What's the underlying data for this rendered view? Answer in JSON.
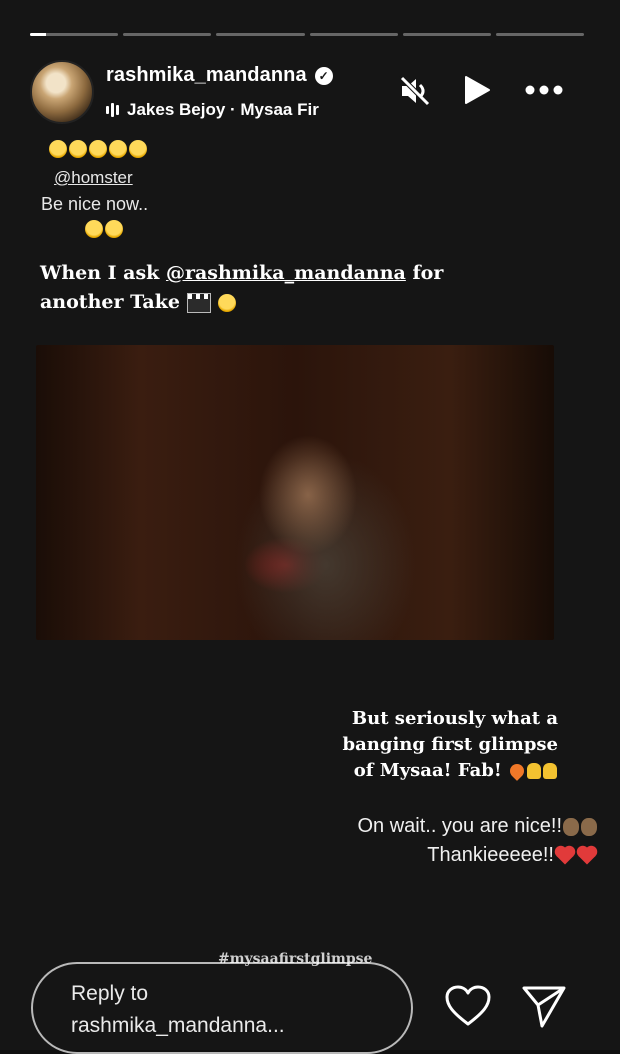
{
  "header": {
    "username": "rashmika_mandanna",
    "verified_icon": "verified-badge-icon",
    "music": "Jakes Bejoy · Mysaa Fir",
    "progress_segments": 6,
    "active_segment_progress": 0.18
  },
  "comment": {
    "mention": "@homster",
    "text": "Be nice now.."
  },
  "caption_top": {
    "prefix": "When I ask ",
    "mention": "@rashmika_mandanna",
    "suffix1": " for",
    "line2": "another Take "
  },
  "caption_bottom": {
    "line1": "But seriously what a",
    "line2": "banging first glimpse",
    "line3": "of Mysaa! Fab! "
  },
  "reply_text": {
    "line1": "On wait.. you are nice!!",
    "line2": "Thankieeeee!!"
  },
  "hashtag": "#mysaafirstglimpse",
  "reply_box": {
    "line1": "Reply to",
    "line2": "rashmika_mandanna..."
  },
  "colors": {
    "background": "#151515",
    "heart": "#e13a3a"
  }
}
